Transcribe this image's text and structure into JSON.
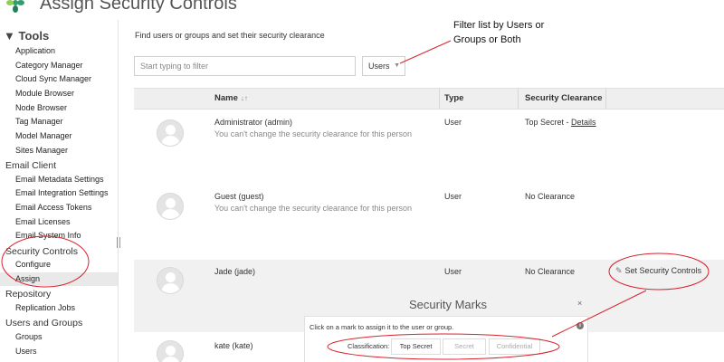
{
  "header": {
    "title": "Assign Security Controls"
  },
  "sidebar": {
    "tools_heading": "▼ Tools",
    "tools_items": [
      "Application",
      "Category Manager",
      "Cloud Sync Manager",
      "Module Browser",
      "Node Browser",
      "Tag Manager",
      "Model Manager",
      "Sites Manager"
    ],
    "email_client": {
      "heading": "Email Client",
      "items": [
        "Email Metadata Settings",
        "Email Integration Settings",
        "Email Access Tokens",
        "Email Licenses",
        "Email System Info"
      ]
    },
    "security_controls": {
      "heading": "Security Controls",
      "items": [
        "Configure",
        "Assign"
      ]
    },
    "repository": {
      "heading": "Repository",
      "items": [
        "Replication Jobs"
      ]
    },
    "users_groups": {
      "heading": "Users and Groups",
      "items": [
        "Groups",
        "Users"
      ]
    }
  },
  "main": {
    "intro": "Find users or groups and set their security clearance",
    "filter_placeholder": "Start typing to filter",
    "type_select": "Users",
    "columns": {
      "name": "Name",
      "type": "Type",
      "clearance": "Security Clearance"
    },
    "rows": [
      {
        "name": "Administrator (admin)",
        "note": "You can't change the security clearance for this person",
        "type": "User",
        "clearance": "Top Secret - ",
        "details": "Details"
      },
      {
        "name": "Guest (guest)",
        "note": "You can't change the security clearance for this person",
        "type": "User",
        "clearance": "No Clearance"
      },
      {
        "name": "Jade (jade)",
        "type": "User",
        "clearance": "No Clearance",
        "action": "Set Security Controls"
      },
      {
        "name": "kate (kate)"
      }
    ]
  },
  "security_marks": {
    "title": "Security Marks",
    "close": "×",
    "hint": "Click on a mark to assign it to the user or group.",
    "info": "i",
    "classification_label": "Classification:",
    "marks": [
      "Top Secret",
      "Secret",
      "Confidential"
    ]
  },
  "annotations": {
    "filter_note_line1": "Filter list by Users or",
    "filter_note_line2": "Groups or Both"
  },
  "colors": {
    "annotation_red": "#d9232e",
    "logo_green": "#2f9e6e"
  }
}
